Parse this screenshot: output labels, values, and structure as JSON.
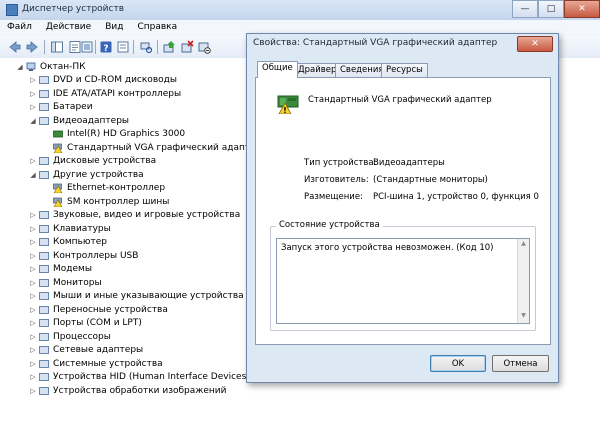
{
  "window": {
    "title": "Диспетчер устройств",
    "min": "—",
    "max": "□",
    "close": "✕"
  },
  "menu": [
    "Файл",
    "Действие",
    "Вид",
    "Справка"
  ],
  "tree": [
    {
      "label": "Октан-ПК",
      "level": 0,
      "expanded": true,
      "icon": "computer-icon"
    },
    {
      "label": "DVD и CD-ROM дисководы",
      "level": 1,
      "icon": "dvd-drive-icon"
    },
    {
      "label": "IDE ATA/ATAPI контроллеры",
      "level": 1,
      "icon": "ide-controller-icon"
    },
    {
      "label": "Батареи",
      "level": 1,
      "icon": "battery-icon"
    },
    {
      "label": "Видеоадаптеры",
      "level": 1,
      "expanded": true,
      "icon": "display-adapter-icon"
    },
    {
      "label": "Intel(R) HD Graphics 3000",
      "level": 2,
      "icon": "display-adapter-icon"
    },
    {
      "label": "Стандартный VGA графический адаптер",
      "level": 2,
      "icon": "warning-adapter-icon",
      "warning": true
    },
    {
      "label": "Дисковые устройства",
      "level": 1,
      "icon": "disk-drive-icon"
    },
    {
      "label": "Другие устройства",
      "level": 1,
      "expanded": true,
      "icon": "other-devices-icon"
    },
    {
      "label": "Ethernet-контроллер",
      "level": 2,
      "icon": "warning-device-icon",
      "warning": true
    },
    {
      "label": "SM контроллер шины",
      "level": 2,
      "icon": "warning-device-icon",
      "warning": true
    },
    {
      "label": "Звуковые, видео и игровые устройства",
      "level": 1,
      "icon": "sound-icon"
    },
    {
      "label": "Клавиатуры",
      "level": 1,
      "icon": "keyboard-icon"
    },
    {
      "label": "Компьютер",
      "level": 1,
      "icon": "computer-icon"
    },
    {
      "label": "Контроллеры USB",
      "level": 1,
      "icon": "usb-icon"
    },
    {
      "label": "Модемы",
      "level": 1,
      "icon": "modem-icon"
    },
    {
      "label": "Мониторы",
      "level": 1,
      "icon": "monitor-icon"
    },
    {
      "label": "Мыши и иные указывающие устройства",
      "level": 1,
      "icon": "mouse-icon"
    },
    {
      "label": "Переносные устройства",
      "level": 1,
      "icon": "portable-device-icon"
    },
    {
      "label": "Порты (COM и LPT)",
      "level": 1,
      "icon": "port-icon"
    },
    {
      "label": "Процессоры",
      "level": 1,
      "icon": "processor-icon"
    },
    {
      "label": "Сетевые адаптеры",
      "level": 1,
      "icon": "network-adapter-icon"
    },
    {
      "label": "Системные устройства",
      "level": 1,
      "icon": "system-device-icon"
    },
    {
      "label": "Устройства HID (Human Interface Devices)",
      "level": 1,
      "icon": "hid-icon"
    },
    {
      "label": "Устройства обработки изображений",
      "level": 1,
      "icon": "imaging-device-icon"
    }
  ],
  "dialog": {
    "title": "Свойства: Стандартный VGA графический адаптер",
    "close": "✕",
    "tabs": [
      "Общие",
      "Драйвер",
      "Сведения",
      "Ресурсы"
    ],
    "device_name": "Стандартный VGA графический адаптер",
    "fields": {
      "type_label": "Тип устройства:",
      "type_value": "Видеоадаптеры",
      "maker_label": "Изготовитель:",
      "maker_value": "(Стандартные мониторы)",
      "location_label": "Размещение:",
      "location_value": "PCI-шина 1, устройство 0, функция 0"
    },
    "status_group": "Состояние устройства",
    "status_text": "Запуск этого устройства невозможен. (Код 10)",
    "ok": "OK",
    "cancel": "Отмена"
  }
}
